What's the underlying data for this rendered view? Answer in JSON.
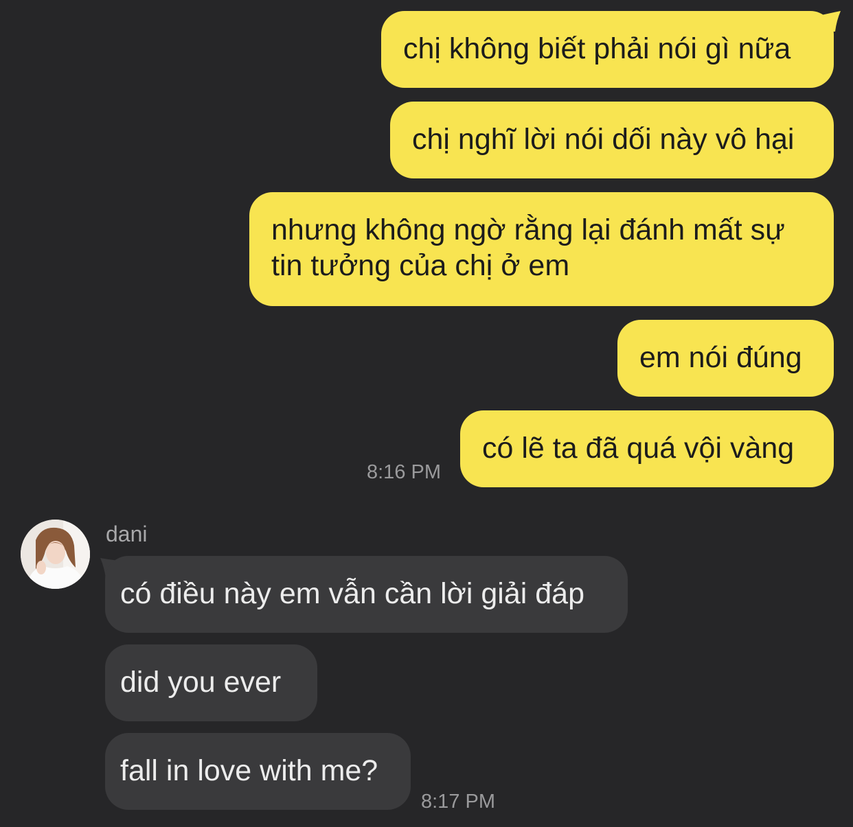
{
  "conversation": {
    "outgoing": [
      {
        "text": "chị không biết phải nói gì nữa"
      },
      {
        "text": "chị nghĩ lời nói dối này vô hại"
      },
      {
        "line1": "nhưng không ngờ rằng lại đánh mất sự",
        "line2": "tin tưởng của chị ở em"
      },
      {
        "text": "em nói đúng"
      },
      {
        "text": "có lẽ ta đã quá vội vàng"
      }
    ],
    "outgoing_time": "8:16 PM",
    "sender": {
      "name": "dani",
      "avatar": "profile-photo"
    },
    "incoming": [
      {
        "text": "có điều này em vẫn cần lời giải đáp"
      },
      {
        "text": "did you ever"
      },
      {
        "text": "fall in love with me?"
      }
    ],
    "incoming_time": "8:17 PM"
  },
  "colors": {
    "background": "#262628",
    "outgoing_bubble": "#f8e451",
    "incoming_bubble": "#3a3a3c",
    "timestamp": "#9a9a9c"
  }
}
